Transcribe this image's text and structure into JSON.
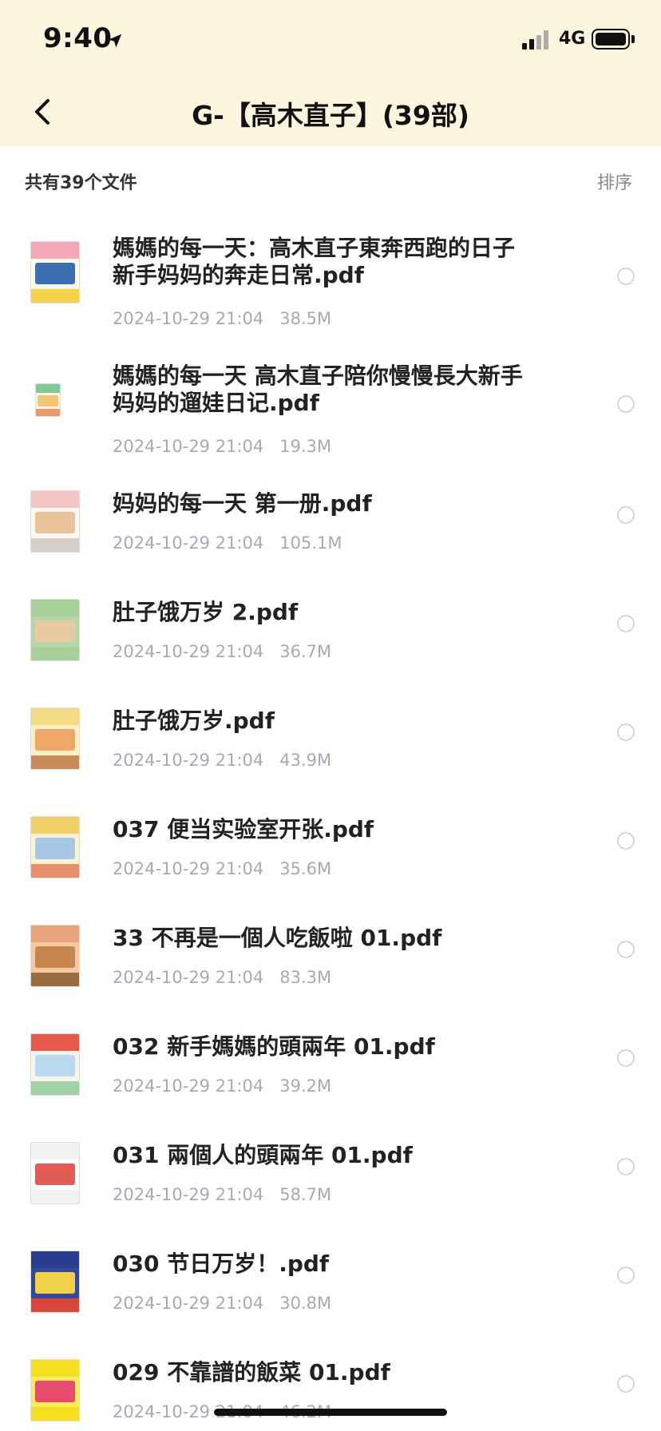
{
  "status_bar": {
    "time": "9:40",
    "network": "4G",
    "icons": [
      "location-arrow-icon",
      "signal-icon",
      "battery-icon"
    ]
  },
  "nav": {
    "title": "G-【高木直子】(39部)",
    "back_icon": "chevron-left-icon"
  },
  "list": {
    "count_label": "共有39个文件",
    "sort_label": "排序"
  },
  "files": [
    {
      "name": "媽媽的每一天：高木直子東奔西跑的日子新手妈妈的奔走日常.pdf",
      "date": "2024-10-29 21:04",
      "size": "38.5M",
      "thumb": {
        "top": "#f1a7b5",
        "mid": "#3a6fb0",
        "bot": "#f3d34a",
        "bg": "#fff8e8"
      }
    },
    {
      "name": "媽媽的每一天 高木直子陪你慢慢長大新手妈妈的遛娃日记.pdf",
      "date": "2024-10-29 21:04",
      "size": "19.3M",
      "thumb": {
        "top": "#7fc99a",
        "mid": "#f2c572",
        "bot": "#e79a6a",
        "bg": "#f6f2e4"
      }
    },
    {
      "name": "妈妈的每一天 第一册.pdf",
      "date": "2024-10-29 21:04",
      "size": "105.1M",
      "thumb": {
        "top": "#f4c6c6",
        "mid": "#e8c39a",
        "bot": "#d7d0c8",
        "bg": "#fbf8f4"
      }
    },
    {
      "name": "肚子饿万岁 2.pdf",
      "date": "2024-10-29 21:04",
      "size": "36.7M",
      "thumb": {
        "top": "#a9cf9b",
        "mid": "#e7caa0",
        "bot": "#a9cf9b",
        "bg": "#b5d7a7"
      }
    },
    {
      "name": "肚子饿万岁.pdf",
      "date": "2024-10-29 21:04",
      "size": "43.9M",
      "thumb": {
        "top": "#f4dc86",
        "mid": "#f0a868",
        "bot": "#c98b58",
        "bg": "#fbefc5"
      }
    },
    {
      "name": "037 便当实验室开张.pdf",
      "date": "2024-10-29 21:04",
      "size": "35.6M",
      "thumb": {
        "top": "#f2d06a",
        "mid": "#a7c7e6",
        "bot": "#e78f6a",
        "bg": "#fbf2d6"
      }
    },
    {
      "name": "33 不再是一個人吃飯啦 01.pdf",
      "date": "2024-10-29 21:04",
      "size": "83.3M",
      "thumb": {
        "top": "#e8a47c",
        "mid": "#c5864d",
        "bot": "#9a6b3e",
        "bg": "#f4c9a2"
      }
    },
    {
      "name": "032 新手媽媽的頭兩年 01.pdf",
      "date": "2024-10-29 21:04",
      "size": "39.2M",
      "thumb": {
        "top": "#e65a4a",
        "mid": "#b9d9ef",
        "bot": "#9fd0a6",
        "bg": "#f7f3ec"
      }
    },
    {
      "name": "031 兩個人的頭兩年 01.pdf",
      "date": "2024-10-29 21:04",
      "size": "58.7M",
      "thumb": {
        "top": "#f2f2f2",
        "mid": "#e35b55",
        "bot": "#f2f2f2",
        "bg": "#ffffff"
      }
    },
    {
      "name": "030 节日万岁！.pdf",
      "date": "2024-10-29 21:04",
      "size": "30.8M",
      "thumb": {
        "top": "#2a3d8f",
        "mid": "#f1d04a",
        "bot": "#d9463a",
        "bg": "#33489c"
      }
    },
    {
      "name": "029 不靠譜的飯菜 01.pdf",
      "date": "2024-10-29 21:04",
      "size": "46.2M",
      "thumb": {
        "top": "#f4e021",
        "mid": "#e64a6e",
        "bot": "#f4e021",
        "bg": "#f8ec5a"
      }
    }
  ]
}
